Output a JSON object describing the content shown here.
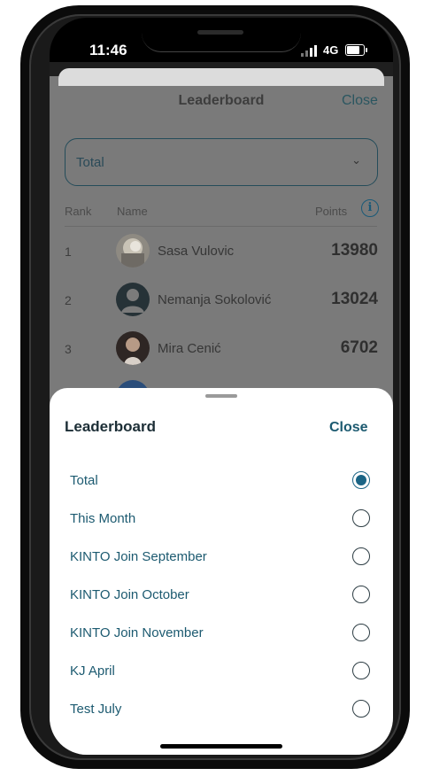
{
  "status_bar": {
    "time": "11:46",
    "network": "4G"
  },
  "background": {
    "title": "Leaderboard",
    "close_label": "Close",
    "filter": {
      "value": "Total"
    },
    "columns": {
      "rank": "Rank",
      "name": "Name",
      "points": "Points"
    },
    "rows": [
      {
        "rank": "1",
        "name": "Sasa Vulovic",
        "points": "13980"
      },
      {
        "rank": "2",
        "name": "Nemanja Sokolović",
        "points": "13024"
      },
      {
        "rank": "3",
        "name": "Mira Cenić",
        "points": "6702"
      }
    ]
  },
  "sheet": {
    "title": "Leaderboard",
    "close_label": "Close",
    "options": [
      {
        "label": "Total",
        "selected": true
      },
      {
        "label": "This Month",
        "selected": false
      },
      {
        "label": "KINTO Join September",
        "selected": false
      },
      {
        "label": "KINTO Join October",
        "selected": false
      },
      {
        "label": "KINTO Join November",
        "selected": false
      },
      {
        "label": "KJ April",
        "selected": false
      },
      {
        "label": "Test July",
        "selected": false
      }
    ]
  },
  "colors": {
    "accent": "#1a6485",
    "overlay": "#7a7a7a"
  }
}
